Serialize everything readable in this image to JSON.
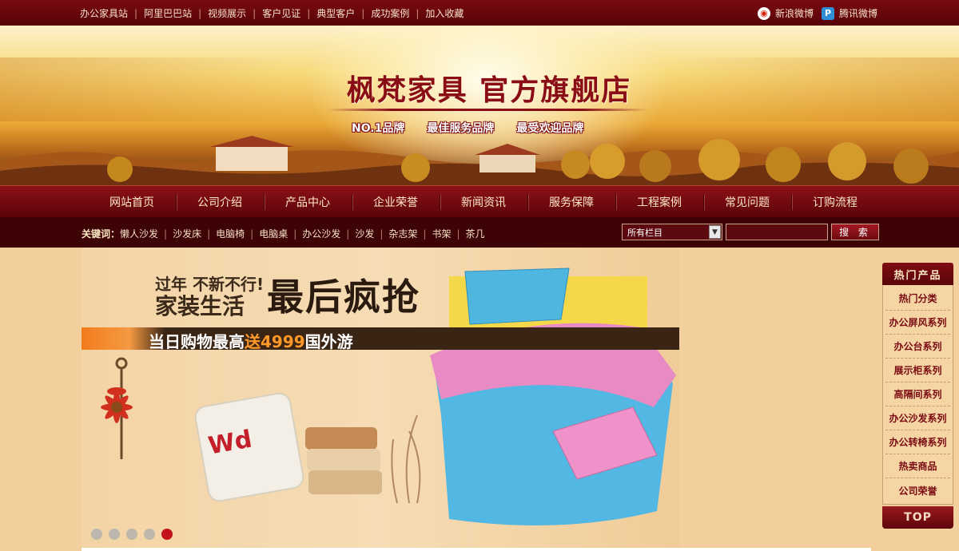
{
  "topbar": {
    "links": [
      "办公家具站",
      "阿里巴巴站",
      "视频展示",
      "客户见证",
      "典型客户",
      "成功案例",
      "加入收藏"
    ],
    "sina_label": "新浪微博",
    "tencent_label": "腾讯微博"
  },
  "banner": {
    "title": "枫梵家具 官方旗舰店",
    "slogans": [
      "NO.1品牌",
      "最佳服务品牌",
      "最受欢迎品牌"
    ]
  },
  "nav": {
    "items": [
      "网站首页",
      "公司介绍",
      "产品中心",
      "企业荣誉",
      "新闻资讯",
      "服务保障",
      "工程案例",
      "常见问题",
      "订购流程"
    ]
  },
  "keywords": {
    "label": "关键词：",
    "items": [
      "懒人沙发",
      "沙发床",
      "电脑椅",
      "电脑桌",
      "办公沙发",
      "沙发",
      "杂志架",
      "书架",
      "茶几"
    ]
  },
  "search": {
    "select_value": "所有栏目",
    "input_value": "",
    "button_label": "搜 索"
  },
  "slide": {
    "line1": "过年 不新不行!",
    "line2": "家装生活",
    "headline": "最后疯抢",
    "strip_before": "当日购物最高",
    "strip_highlight": "送4999",
    "strip_after": "国外游",
    "dot_count": 5,
    "active_index": 4
  },
  "sidebar": {
    "title": "热门产品",
    "items": [
      "热门分类",
      "办公屏风系列",
      "办公台系列",
      "展示柜系列",
      "高隔间系列",
      "办公沙发系列",
      "办公转椅系列",
      "热卖商品",
      "公司荣誉"
    ],
    "top_label": "TOP"
  },
  "colors": {
    "brand_red": "#7a0b12",
    "dot_active": "#c4121a"
  }
}
